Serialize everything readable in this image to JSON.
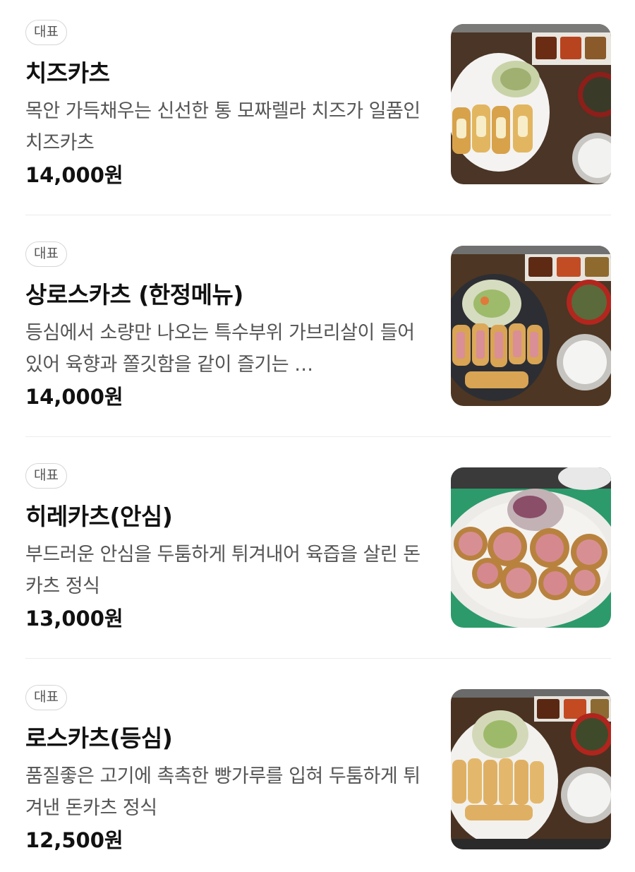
{
  "menu": {
    "items": [
      {
        "badge": "대표",
        "name": "치즈카츠",
        "description": "목안 가득채우는 신선한 통 모짜렐라 치즈가 일품인 치즈카츠",
        "price": "14,000원",
        "image_icon": "food-photo-icon"
      },
      {
        "badge": "대표",
        "name": "상로스카츠 (한정메뉴)",
        "description": "등심에서 소량만 나오는 특수부위 가브리살이 들어있어 육향과 쫄깃함을 같이 즐기는 …",
        "price": "14,000원",
        "image_icon": "food-photo-icon"
      },
      {
        "badge": "대표",
        "name": "히레카츠(안심)",
        "description": "부드러운 안심을 두툼하게 튀겨내어 육즙을 살린 돈카츠 정식",
        "price": "13,000원",
        "image_icon": "food-photo-icon"
      },
      {
        "badge": "대표",
        "name": "로스카츠(등심)",
        "description": "품질좋은 고기에 촉촉한 빵가루를 입혀 두툼하게 튀겨낸 돈카츠 정식",
        "price": "12,500원",
        "image_icon": "food-photo-icon"
      }
    ]
  },
  "colors": {
    "text_primary": "#111111",
    "text_secondary": "#555555",
    "badge_border": "#d6d6d6",
    "divider": "#ececec"
  }
}
